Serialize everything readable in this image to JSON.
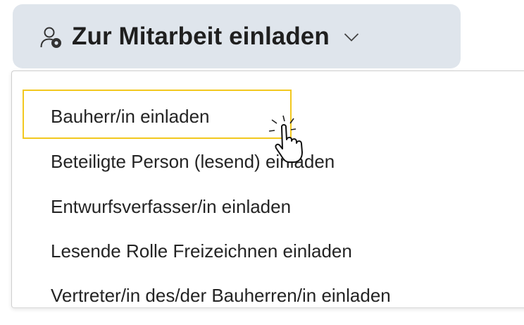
{
  "invite_button": {
    "label": "Zur Mitarbeit einladen",
    "icon": "user-add-icon",
    "chevron_icon": "chevron-down-icon"
  },
  "dropdown": {
    "items": [
      {
        "label": "Bauherr/in einladen"
      },
      {
        "label": "Beteiligte Person (lesend) einladen"
      },
      {
        "label": "Entwurfsverfasser/in einladen"
      },
      {
        "label": "Lesende Rolle Freizeichnen einladen"
      },
      {
        "label": "Vertreter/in des/der Bauherren/in einladen"
      }
    ],
    "highlighted_index": 0
  },
  "colors": {
    "button_background": "#dfe5ec",
    "highlight_border": "#f2c81f",
    "text": "#242424"
  },
  "cursor": {
    "icon": "hand-pointer-icon"
  }
}
